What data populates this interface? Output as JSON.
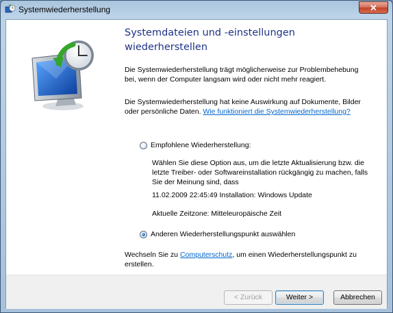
{
  "window": {
    "title": "Systemwiederherstellung",
    "close_label": "✕"
  },
  "heading": "Systemdateien und -einstellungen wiederherstellen",
  "intro": "Die Systemwiederherstellung trägt möglicherweise zur Problembehebung bei, wenn der Computer langsam wird oder nicht mehr reagiert.",
  "info_text": "Die Systemwiederherstellung hat keine Auswirkung auf Dokumente, Bilder oder persönliche Daten. ",
  "info_link": "Wie funktioniert die Systemwiederherstellung?",
  "options": {
    "recommended_label": "Empfohlene Wiederherstellung:",
    "recommended_description": "Wählen Sie diese Option aus, um die letzte Aktualisierung bzw. die letzte Treiber- oder Softwareinstallation rückgängig zu machen, falls Sie der Meinung sind, dass",
    "restore_point": "11.02.2009 22:45:49 Installation: Windows Update",
    "timezone": "Aktuelle Zeitzone: Mitteleuropäische Zeit",
    "other_label": "Anderen Wiederherstellungspunkt auswählen",
    "selected": "other"
  },
  "protection": {
    "prefix": "Wechseln Sie zu ",
    "link": "Computerschutz",
    "suffix": ", um einen Wiederherstellungspunkt zu erstellen."
  },
  "buttons": {
    "back": "< Zurück",
    "next": "Weiter >",
    "cancel": "Abbrechen"
  },
  "icons": {
    "app": "system-restore-icon",
    "art": "monitor-clock-restore-icon"
  }
}
